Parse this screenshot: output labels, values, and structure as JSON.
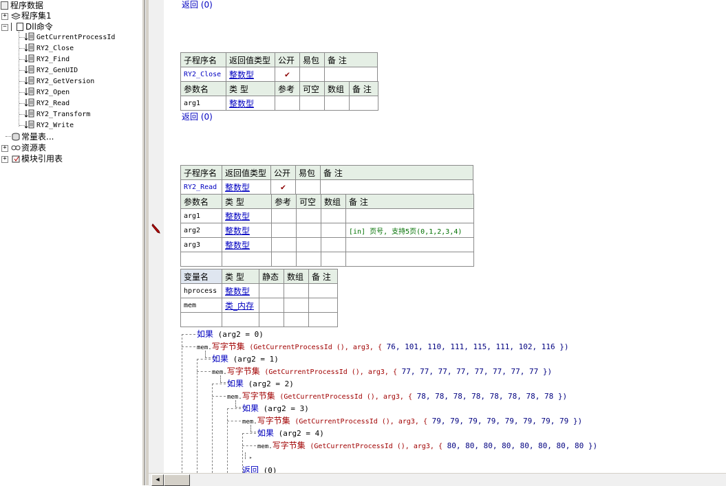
{
  "tree": {
    "root": "程序数据",
    "program_set": "程序集1",
    "dll_group": "Dll命令",
    "dll_items": [
      "GetCurrentProcessId",
      "RY2_Close",
      "RY2_Find",
      "RY2_GenUID",
      "RY2_GetVersion",
      "RY2_Open",
      "RY2_Read",
      "RY2_Transform",
      "RY2_Write"
    ],
    "constants": "常量表...",
    "resources": "资源表",
    "module_refs": "模块引用表"
  },
  "top_return": "返回 (0)",
  "close_sub": {
    "headers": [
      "子程序名",
      "返回值类型",
      "公开",
      "易包",
      "备 注"
    ],
    "name": "RY2_Close",
    "ret_type": "整数型",
    "public_mark": "✔",
    "param_headers": [
      "参数名",
      "类 型",
      "参考",
      "可空",
      "数组",
      "备 注"
    ],
    "params": [
      {
        "name": "arg1",
        "type": "整数型"
      }
    ],
    "return_line": "返回 (0)"
  },
  "read_sub": {
    "headers": [
      "子程序名",
      "返回值类型",
      "公开",
      "易包",
      "备 注"
    ],
    "name": "RY2_Read",
    "ret_type": "整数型",
    "public_mark": "✔",
    "param_headers": [
      "参数名",
      "类 型",
      "参考",
      "可空",
      "数组",
      "备 注"
    ],
    "params": [
      {
        "name": "arg1",
        "type": "整数型",
        "note": ""
      },
      {
        "name": "arg2",
        "type": "整数型",
        "note": "[in] 页号, 支持5页(0,1,2,3,4)"
      },
      {
        "name": "arg3",
        "type": "整数型",
        "note": ""
      }
    ],
    "var_headers": [
      "变量名",
      "类 型",
      "静态",
      "数组",
      "备 注"
    ],
    "vars": [
      {
        "name": "hprocess",
        "type": "整数型"
      },
      {
        "name": "mem",
        "type": "类_内存"
      }
    ]
  },
  "code": {
    "if_kw": "如果",
    "obj": "mem.",
    "write_fn": "写字节集",
    "pid_call": "(GetCurrentProcessId (), arg3, {",
    "conds": [
      "(arg2 = 0)",
      "(arg2 = 1)",
      "(arg2 = 2)",
      "(arg2 = 3)",
      "(arg2 = 4)"
    ],
    "bytes": [
      "76, 101, 110, 111, 115, 111, 102, 116 })",
      "77, 77, 77, 77, 77, 77, 77, 77 })",
      "78, 78, 78, 78, 78, 78, 78, 78 })",
      "79, 79, 79, 79, 79, 79, 79, 79 })",
      "80, 80, 80, 80, 80, 80, 80, 80 })"
    ],
    "return_kw": "返回",
    "return_val": "(0)"
  },
  "scroll_left": "◀"
}
